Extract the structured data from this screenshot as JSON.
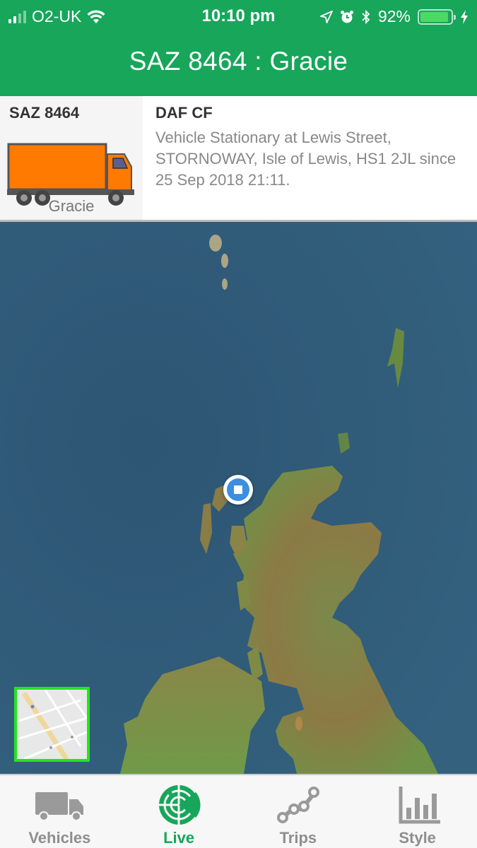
{
  "status_bar": {
    "carrier": "O2-UK",
    "time": "10:10 pm",
    "battery_percent": "92%",
    "battery_level": 0.92,
    "signal_bars": 2,
    "signal_bars_total": 4,
    "icons": [
      "signal-icon",
      "wifi-icon",
      "location-arrow-icon",
      "alarm-icon",
      "bluetooth-icon",
      "battery-icon",
      "charging-bolt-icon"
    ]
  },
  "header": {
    "title": "SAZ 8464 : Gracie"
  },
  "vehicle_card": {
    "registration": "SAZ 8464",
    "nickname": "Gracie",
    "model": "DAF CF",
    "status_text": "Vehicle Stationary at Lewis Street, STORNOWAY, Isle of Lewis, HS1 2JL since 25 Sep 2018 21:11.",
    "truck_color": "#ff7a00"
  },
  "map": {
    "view": "satellite",
    "marker": {
      "type": "stationary",
      "color": "#3a8fe0"
    },
    "minimap": {
      "view": "street",
      "border_color": "#22e61e"
    }
  },
  "tabbar": {
    "active": "live",
    "accent_color": "#17a65a",
    "tabs": [
      {
        "id": "vehicles",
        "label": "Vehicles",
        "icon": "truck-icon"
      },
      {
        "id": "live",
        "label": "Live",
        "icon": "radar-icon"
      },
      {
        "id": "trips",
        "label": "Trips",
        "icon": "route-icon"
      },
      {
        "id": "style",
        "label": "Style",
        "icon": "bar-chart-icon"
      }
    ]
  }
}
